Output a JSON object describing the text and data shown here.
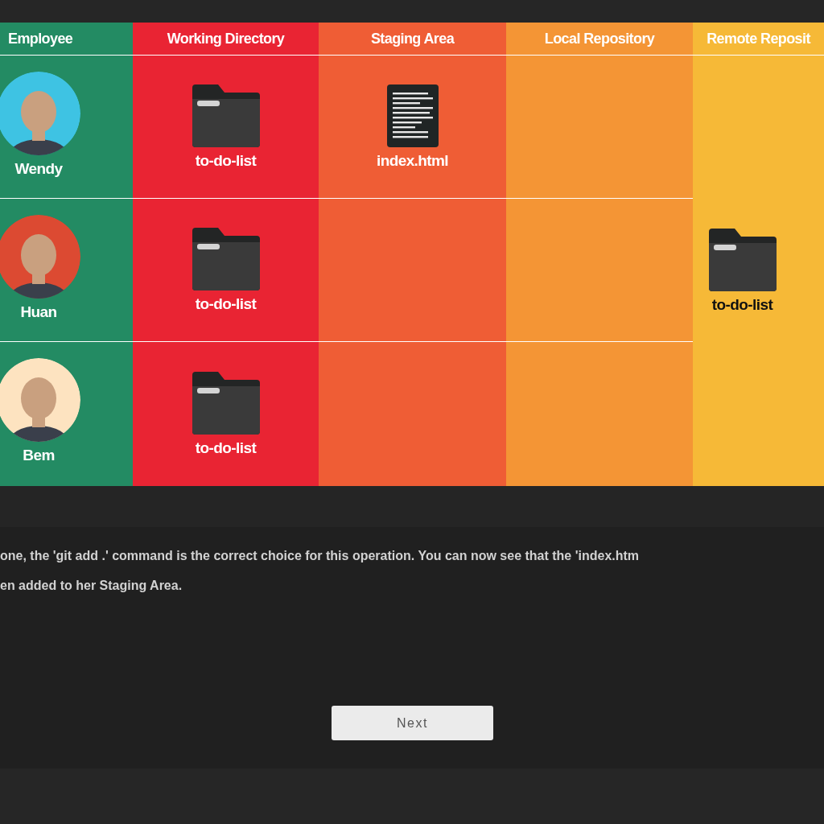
{
  "table": {
    "columns": [
      "Employee",
      "Working Directory",
      "Staging Area",
      "Local Repository",
      "Remote Reposit"
    ],
    "rows": [
      {
        "employee": {
          "name": "Wendy",
          "color": "#3ec3e3"
        },
        "working_directory": [
          {
            "kind": "folder",
            "name": "to-do-list"
          }
        ],
        "staging_area": [
          {
            "kind": "file",
            "name": "index.html"
          }
        ],
        "local_repository": []
      },
      {
        "employee": {
          "name": "Huan",
          "color": "#dc4a32"
        },
        "working_directory": [
          {
            "kind": "folder",
            "name": "to-do-list"
          }
        ],
        "staging_area": [],
        "local_repository": []
      },
      {
        "employee": {
          "name": "Bem",
          "color": "#fde3c0"
        },
        "working_directory": [
          {
            "kind": "folder",
            "name": "to-do-list"
          }
        ],
        "staging_area": [],
        "local_repository": []
      }
    ],
    "remote_repository": [
      {
        "kind": "folder",
        "name": "to-do-list"
      }
    ]
  },
  "message": [
    "one, the 'git add .' command is the correct choice for this operation. You can now see that the 'index.htm",
    "en added to her Staging Area."
  ],
  "next_button": "Next"
}
